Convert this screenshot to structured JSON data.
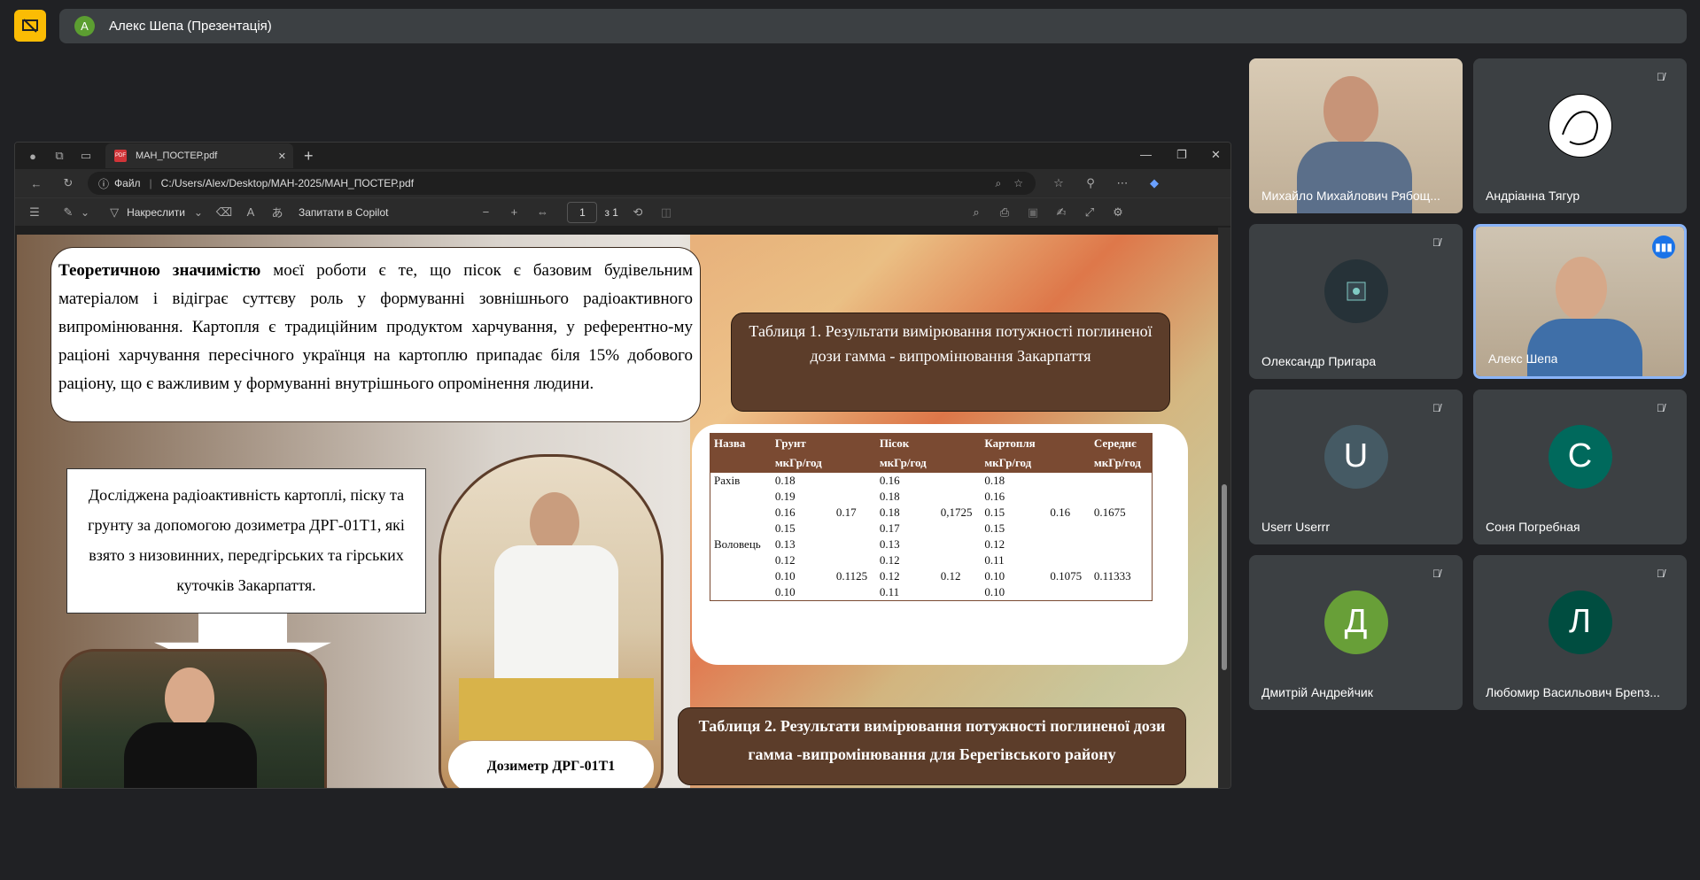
{
  "meeting": {
    "presenter_avatar_letter": "А",
    "presenter_title": "Алекс Шепа (Презентація)"
  },
  "browser": {
    "tab_title": "МАН_ПОСТЕР.pdf",
    "addr_label": "Файл",
    "url": "C:/Users/Alex/Desktop/МАН-2025/МАН_ПОСТЕР.pdf",
    "draw_label": "Накреслити",
    "copilot_label": "Запитати в Copilot",
    "page_current": "1",
    "page_total": "з 1"
  },
  "poster": {
    "theory_bold": "Теоретичною значимістю",
    "theory_rest": " моєї роботи є те, що пісок є базовим будівельним матеріалом і відіграє суттєву роль у формуванні зовнішнього радіоактивного випромінювання. Картопля є традиційним продуктом харчування, у референтно-му раціоні харчування пересічного українця на картоплю припадає біля 15% добового раціону, що є важливим у формуванні внутрішнього опромінення людини.",
    "studied": "Досліджена радіоактивність картоплі, піску та грунту за допомогою дозиметра ДРГ-01Т1, які взято з низовинних, передгірських та гірських куточків Закарпаття.",
    "table1_title": "Таблиця 1. Результати вимірювання потужності поглиненої дози  гамма - випромінювання Закарпаття",
    "table2_title": "Таблиця 2. Результати вимірювання потужності поглиненої дози гамма -випромінювання для Берегівського району",
    "dose_label": "Дозиметр ДРГ-01Т1",
    "table": {
      "headers": [
        "Назва",
        "Грунт",
        "",
        "Пісок",
        "",
        "Картопля",
        "",
        "Середнє"
      ],
      "units": [
        "",
        "мкГр/год",
        "",
        "мкГр/год",
        "",
        "мкГр/год",
        "",
        "мкГр/год"
      ],
      "rows": [
        [
          "Рахів",
          "0.18",
          "",
          "0.16",
          "",
          "0.18",
          "",
          ""
        ],
        [
          "",
          "0.19",
          "",
          "0.18",
          "",
          "0.16",
          "",
          ""
        ],
        [
          "",
          "0.16",
          "0.17",
          "0.18",
          "0,1725",
          "0.15",
          "0.16",
          "0.1675"
        ],
        [
          "",
          "0.15",
          "",
          "0.17",
          "",
          "0.15",
          "",
          ""
        ],
        [
          "Воловець",
          "0.13",
          "",
          "0.13",
          "",
          "0.12",
          "",
          ""
        ],
        [
          "",
          "0.12",
          "",
          "0.12",
          "",
          "0.11",
          "",
          ""
        ],
        [
          "",
          "0.10",
          "0.1125",
          "0.12",
          "0.12",
          "0.10",
          "0.1075",
          "0.11333"
        ],
        [
          "",
          "0.10",
          "",
          "0.11",
          "",
          "0.10",
          "",
          ""
        ]
      ]
    }
  },
  "participants": [
    {
      "name": "Михайло Михайлович Рябощ...",
      "letter": "",
      "color": "",
      "muted": false
    },
    {
      "name": "Андріанна Тягур",
      "letter": "",
      "color": "",
      "muted": true
    },
    {
      "name": "Олександр Пригара",
      "letter": "",
      "color": "",
      "muted": true
    },
    {
      "name": "Алекс Шепа",
      "letter": "",
      "color": "",
      "muted": false
    },
    {
      "name": "Userr Userrr",
      "letter": "U",
      "color": "#455a64",
      "muted": true
    },
    {
      "name": "Соня Погребная",
      "letter": "С",
      "color": "#00695c",
      "muted": true
    },
    {
      "name": "Дмитрій Андрейчик",
      "letter": "Д",
      "color": "#689f38",
      "muted": true
    },
    {
      "name": "Любомир Васильович Брenз...",
      "letter": "Л",
      "color": "#004d40",
      "muted": true
    }
  ]
}
